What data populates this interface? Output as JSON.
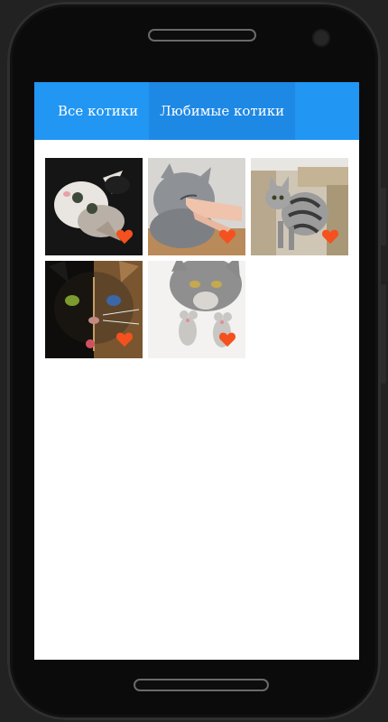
{
  "tabs": [
    {
      "label": "Все котики",
      "active": false
    },
    {
      "label": "Любимые котики",
      "active": true
    }
  ],
  "accent_color": "#2196f3",
  "favorite_icon_color": "#f4511e",
  "gallery": [
    {
      "subject": "white-kitten",
      "favorite": true
    },
    {
      "subject": "gray-cat-hand",
      "favorite": true
    },
    {
      "subject": "tabby-cat",
      "favorite": true
    },
    {
      "subject": "chimera-cat",
      "favorite": true
    },
    {
      "subject": "cat-with-mice",
      "favorite": true
    }
  ]
}
